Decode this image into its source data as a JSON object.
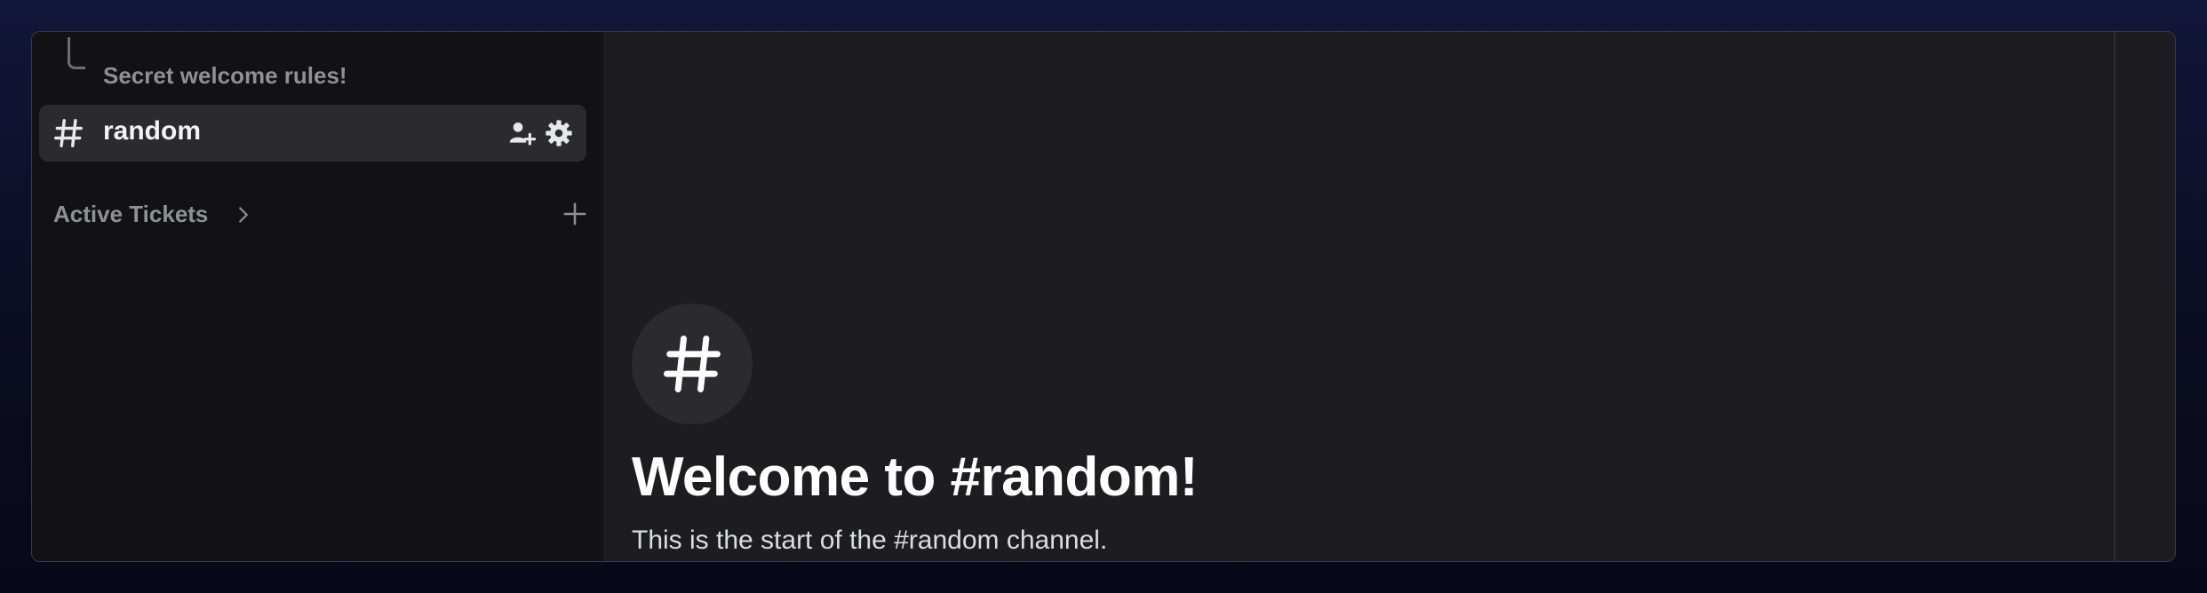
{
  "sidebar": {
    "thread": {
      "label": "Secret welcome rules!"
    },
    "channel": {
      "label": "random",
      "icon": "hash-icon",
      "actions": [
        {
          "icon": "add-member-icon"
        },
        {
          "icon": "gear-icon"
        }
      ]
    },
    "category": {
      "label": "Active Tickets",
      "chevron_icon": "chevron-right-icon",
      "add_icon": "plus-icon"
    }
  },
  "main": {
    "welcome": {
      "icon": "hash-icon",
      "title": "Welcome to #random!",
      "subtitle": "This is the start of the #random channel."
    }
  },
  "colors": {
    "sidebar_bg": "#121214",
    "main_bg": "#1c1c21",
    "selected_channel_bg": "#2a2a2f",
    "muted_text": "#8e8f98"
  }
}
